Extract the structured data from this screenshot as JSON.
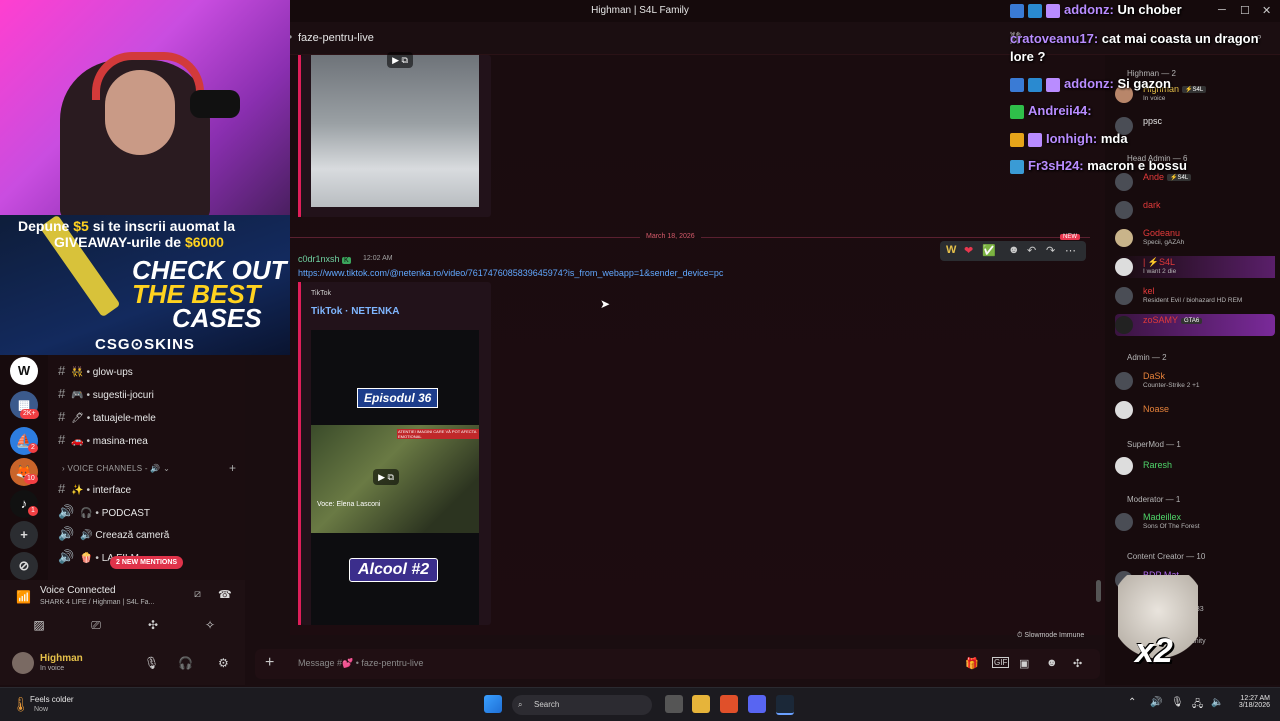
{
  "window": {
    "title": "Highman | S4L Family"
  },
  "channel_header": {
    "name": "faze-pentru-live"
  },
  "webcam_ad": {
    "line1_a": "Depune ",
    "line1_b": "$5",
    "line1_c": " si te inscrii auomat la",
    "line2_a": "GIVEAWAY-urile de ",
    "line2_b": "$6000",
    "check_out": "CHECK OUT",
    "the_best": "THE BEST",
    "cases": "CASES",
    "brand": "CSG⊙SKINS"
  },
  "servers": {
    "badge1": "2K+",
    "badge2": "2",
    "badge3": "10",
    "badge4": "1"
  },
  "channels": [
    {
      "label": "glow-ups",
      "emoji": "👯"
    },
    {
      "label": "sugestii-jocuri",
      "emoji": "🎮"
    },
    {
      "label": "tatuajele-mele",
      "emoji": "🖊"
    },
    {
      "label": "masina-mea",
      "emoji": "🚗"
    }
  ],
  "voice_category": "VOICE CHANNELS - 🔊",
  "voice_channels": [
    {
      "label": "interface",
      "emoji": "✨"
    },
    {
      "label": "PODCAST",
      "emoji": "🎧"
    },
    {
      "label": "Creează cameră",
      "emoji": "🔊"
    },
    {
      "label": "LA FILM",
      "emoji": "🍿"
    }
  ],
  "new_mentions": "2 NEW MENTIONS",
  "voice_panel": {
    "status": "Voice Connected",
    "server": "SHARK 4 LIFE / Highman | S4L Fa..."
  },
  "user_panel": {
    "name": "Highman",
    "status": "In voice"
  },
  "chat": {
    "divider_date": "March 18, 2026",
    "new_label": "NEW",
    "message": {
      "author": "c0dr1nxsh",
      "time": "12:02 AM",
      "link": "https://www.tiktok.com/@netenka.ro/video/7617476085839645974?is_from_webapp=1&sender_device=pc",
      "embed_provider": "TikTok",
      "embed_title": "TikTok · NETENKA",
      "video_episode": "Episodul 36",
      "video_voice": "Voce: Elena Lasconi",
      "video_banner": "ATENTIE! IMAGINI CARE VĂ POT AFECTA EMOTIONAL",
      "video_title": "Alcool #2"
    },
    "hover_toolbar": [
      "W",
      "❤",
      "✅",
      "☻",
      "↶",
      "↷",
      "⋯"
    ],
    "slowmode": "Slowmode Immune",
    "composer_placeholder": "Message #💕 • faze-pentru-live"
  },
  "members": {
    "categories": {
      "highman": "Highman — 2",
      "head_admin": "Head Admin — 6",
      "admin": "Admin — 2",
      "supermod": "SuperMod — 1",
      "moderator": "Moderator — 1",
      "content_creator": "Content Creator — 10"
    },
    "highman_group": [
      {
        "name": "Highman",
        "tag": "⚡S4L",
        "sub": "In voice",
        "color": "#e5c04a"
      },
      {
        "name": "ppsc",
        "sub": "",
        "color": "#e6e6e6"
      }
    ],
    "head_admin_group": [
      {
        "name": "Ande",
        "tag": "⚡S4L",
        "sub": "",
        "color": "#e23a3a"
      },
      {
        "name": "dark",
        "sub": "",
        "color": "#e23a3a"
      },
      {
        "name": "Godeanu",
        "sub": "Specii, gAZAh",
        "color": "#e23a3a"
      },
      {
        "name": "| ⚡S4L",
        "sub": "I want 2 die",
        "color": "#e23a3a"
      },
      {
        "name": "kel",
        "sub": "Resident Evil / biohazard HD REM",
        "color": "#e23a3a"
      },
      {
        "name": "zoSAMY",
        "tag": "GTA6",
        "sub": "",
        "color": "#e23a3a"
      }
    ],
    "admin_group": [
      {
        "name": "DaSk",
        "sub": "Counter-Strike 2 +1",
        "color": "#e5823a"
      },
      {
        "name": "Noase",
        "sub": "",
        "color": "#e5823a"
      }
    ],
    "supermod_group": [
      {
        "name": "Raresh",
        "sub": "",
        "color": "#4fd66a"
      }
    ],
    "moderator_group": [
      {
        "name": "Madeillex",
        "sub": "Sons Of The Forest",
        "color": "#4fd66a"
      }
    ],
    "content_creator_group": [
      {
        "name": "BDP Mat",
        "sub": "",
        "color": "#b06cf0"
      },
      {
        "name": "yx133",
        "sub": "",
        "color": "#b5b5b5"
      },
      {
        "name": "munity",
        "sub": "",
        "color": "#b5b5b5"
      }
    ]
  },
  "stream_chat": [
    {
      "user": "addonz:",
      "text": " Un chober",
      "badge_color": "#3a7bd5"
    },
    {
      "user": "cratoveanu17:",
      "text": " cat mai coasta un dragon lore ?",
      "badge_color": "#3a7bd5"
    },
    {
      "user": "addonz:",
      "text": " Si gazon",
      "badge_color": "#3a7bd5"
    },
    {
      "user": "Andreii44:",
      "text": "",
      "badge_color": "#2fbf4a"
    },
    {
      "user": "Ionhigh:",
      "text": " mda",
      "badge_color": "#e5a41a"
    },
    {
      "user": "Fr3sH24:",
      "text": " macron e bossu",
      "badge_color": "#3a9bd5"
    }
  ],
  "sticker": {
    "text": "x2"
  },
  "taskbar": {
    "weather_title": "Feels colder",
    "weather_sub": "Now",
    "search": "Search",
    "time": "12:27 AM",
    "date": "3/18/2026"
  },
  "colors": {
    "accent": "#e01e5a",
    "link": "#61a8ff",
    "background": "#1a0d10"
  }
}
